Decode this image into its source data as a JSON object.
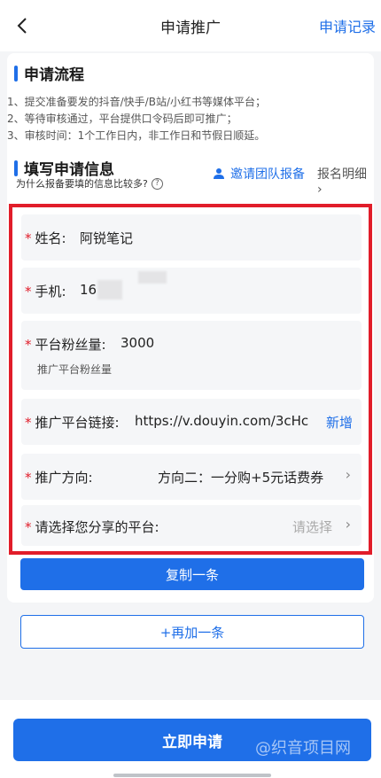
{
  "nav": {
    "title": "申请推广",
    "right": "申请记录"
  },
  "process": {
    "title": "申请流程",
    "steps": [
      "1、提交准备要发的抖音/快手/B站/小红书等媒体平台；",
      "2、等待审核通过，平台提供口令码后即可推广；",
      "3、审核时间：1个工作日内，非工作日和节假日顺延。"
    ]
  },
  "fill": {
    "title": "填写申请信息",
    "hint": "为什么报备要填的信息比较多?",
    "invite": "邀请团队报备",
    "detail": "报名明细",
    "required_mark": "*"
  },
  "form": {
    "name": {
      "label": "姓名:",
      "value": "阿锐笔记"
    },
    "phone": {
      "label": "手机:",
      "value": "16"
    },
    "fans": {
      "label": "平台粉丝量:",
      "value": "3000",
      "sub": "推广平台粉丝量"
    },
    "link": {
      "label": "推广平台链接:",
      "value": "https://v.douyin.com/3cHc",
      "action": "新增"
    },
    "direction": {
      "label": "推广方向:",
      "value": "方向二：一分购+5元话费券"
    },
    "platform": {
      "label": "请选择您分享的平台:",
      "placeholder": "请选择"
    }
  },
  "buttons": {
    "copy": "复制一条",
    "add": "+再加一条",
    "submit": "立即申请"
  },
  "watermark": "@织音项目网",
  "colors": {
    "accent": "#1f6fe8",
    "highlight_border": "#e11d2a",
    "required": "#e11d2a"
  },
  "icons": {
    "back": "chevron-left-icon",
    "help": "question-circle-icon",
    "invite": "user-icon",
    "chevron": "chevron-right-icon"
  }
}
